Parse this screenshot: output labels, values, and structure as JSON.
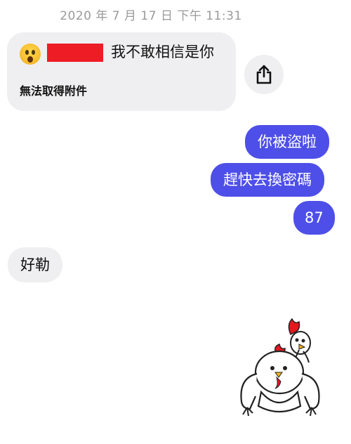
{
  "timestamp": "2020 年 7 月 17 日 下午 11:31",
  "incoming_attachment": {
    "emoji": "astonished-face-icon",
    "message": "我不敢相信是你",
    "failure_text": "無法取得附件",
    "redaction_color": "#ee1c25"
  },
  "share_button": {
    "icon": "share-icon"
  },
  "outgoing": [
    {
      "text": "你被盜啦"
    },
    {
      "text": "趕快去換密碼"
    },
    {
      "text": "87"
    }
  ],
  "incoming_reply": {
    "text": "好勒"
  },
  "sticker": {
    "icon": "chicken-sticker-icon"
  },
  "colors": {
    "outgoing_bubble": "#4e4fe8",
    "incoming_bubble": "#efeff1",
    "timestamp_text": "#9a9a9a"
  }
}
